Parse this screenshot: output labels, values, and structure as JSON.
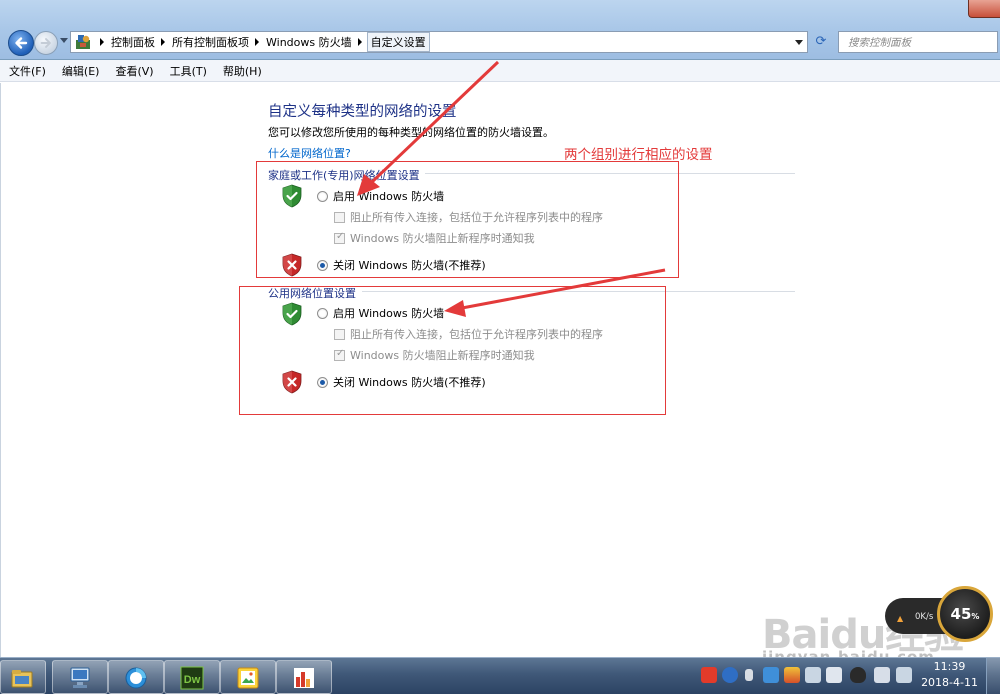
{
  "window": {
    "breadcrumbs": [
      "控制面板",
      "所有控制面板项",
      "Windows 防火墙",
      "自定义设置"
    ],
    "search_placeholder": "搜索控制面板"
  },
  "menu": [
    "文件(F)",
    "编辑(E)",
    "查看(V)",
    "工具(T)",
    "帮助(H)"
  ],
  "page": {
    "title": "自定义每种类型的网络的设置",
    "description": "您可以修改您所使用的每种类型的网络位置的防火墙设置。",
    "help_link": "什么是网络位置?"
  },
  "sections": [
    {
      "heading": "家庭或工作(专用)网络位置设置",
      "enable_label": "启用 Windows 防火墙",
      "block_all_label": "阻止所有传入连接，包括位于允许程序列表中的程序",
      "notify_label": "Windows 防火墙阻止新程序时通知我",
      "disable_label": "关闭 Windows 防火墙(不推荐)",
      "enabled": false,
      "block_all": false,
      "notify": true
    },
    {
      "heading": "公用网络位置设置",
      "enable_label": "启用 Windows 防火墙",
      "block_all_label": "阻止所有传入连接，包括位于允许程序列表中的程序",
      "notify_label": "Windows 防火墙阻止新程序时通知我",
      "disable_label": "关闭 Windows 防火墙(不推荐)",
      "enabled": false,
      "block_all": false,
      "notify": true
    }
  ],
  "annotation": "两个组别进行相应的设置",
  "colors": {
    "annotation": "#e33a3a",
    "heading": "#1e3287",
    "link": "#0066cc"
  },
  "speed_widget": {
    "rate": "0K/s",
    "percent": "45",
    "percent_unit": "%"
  },
  "watermark": {
    "brand": "Baidu经验",
    "url": "jingyan.baidu.com"
  },
  "taskbar": {
    "apps": [
      "windows-explorer",
      "remote-desktop",
      "browser",
      "dreamweaver",
      "photo-viewer",
      "chart-app"
    ],
    "app_dw_label": "Dw",
    "time": "11:39",
    "date": "2018-4-11"
  }
}
